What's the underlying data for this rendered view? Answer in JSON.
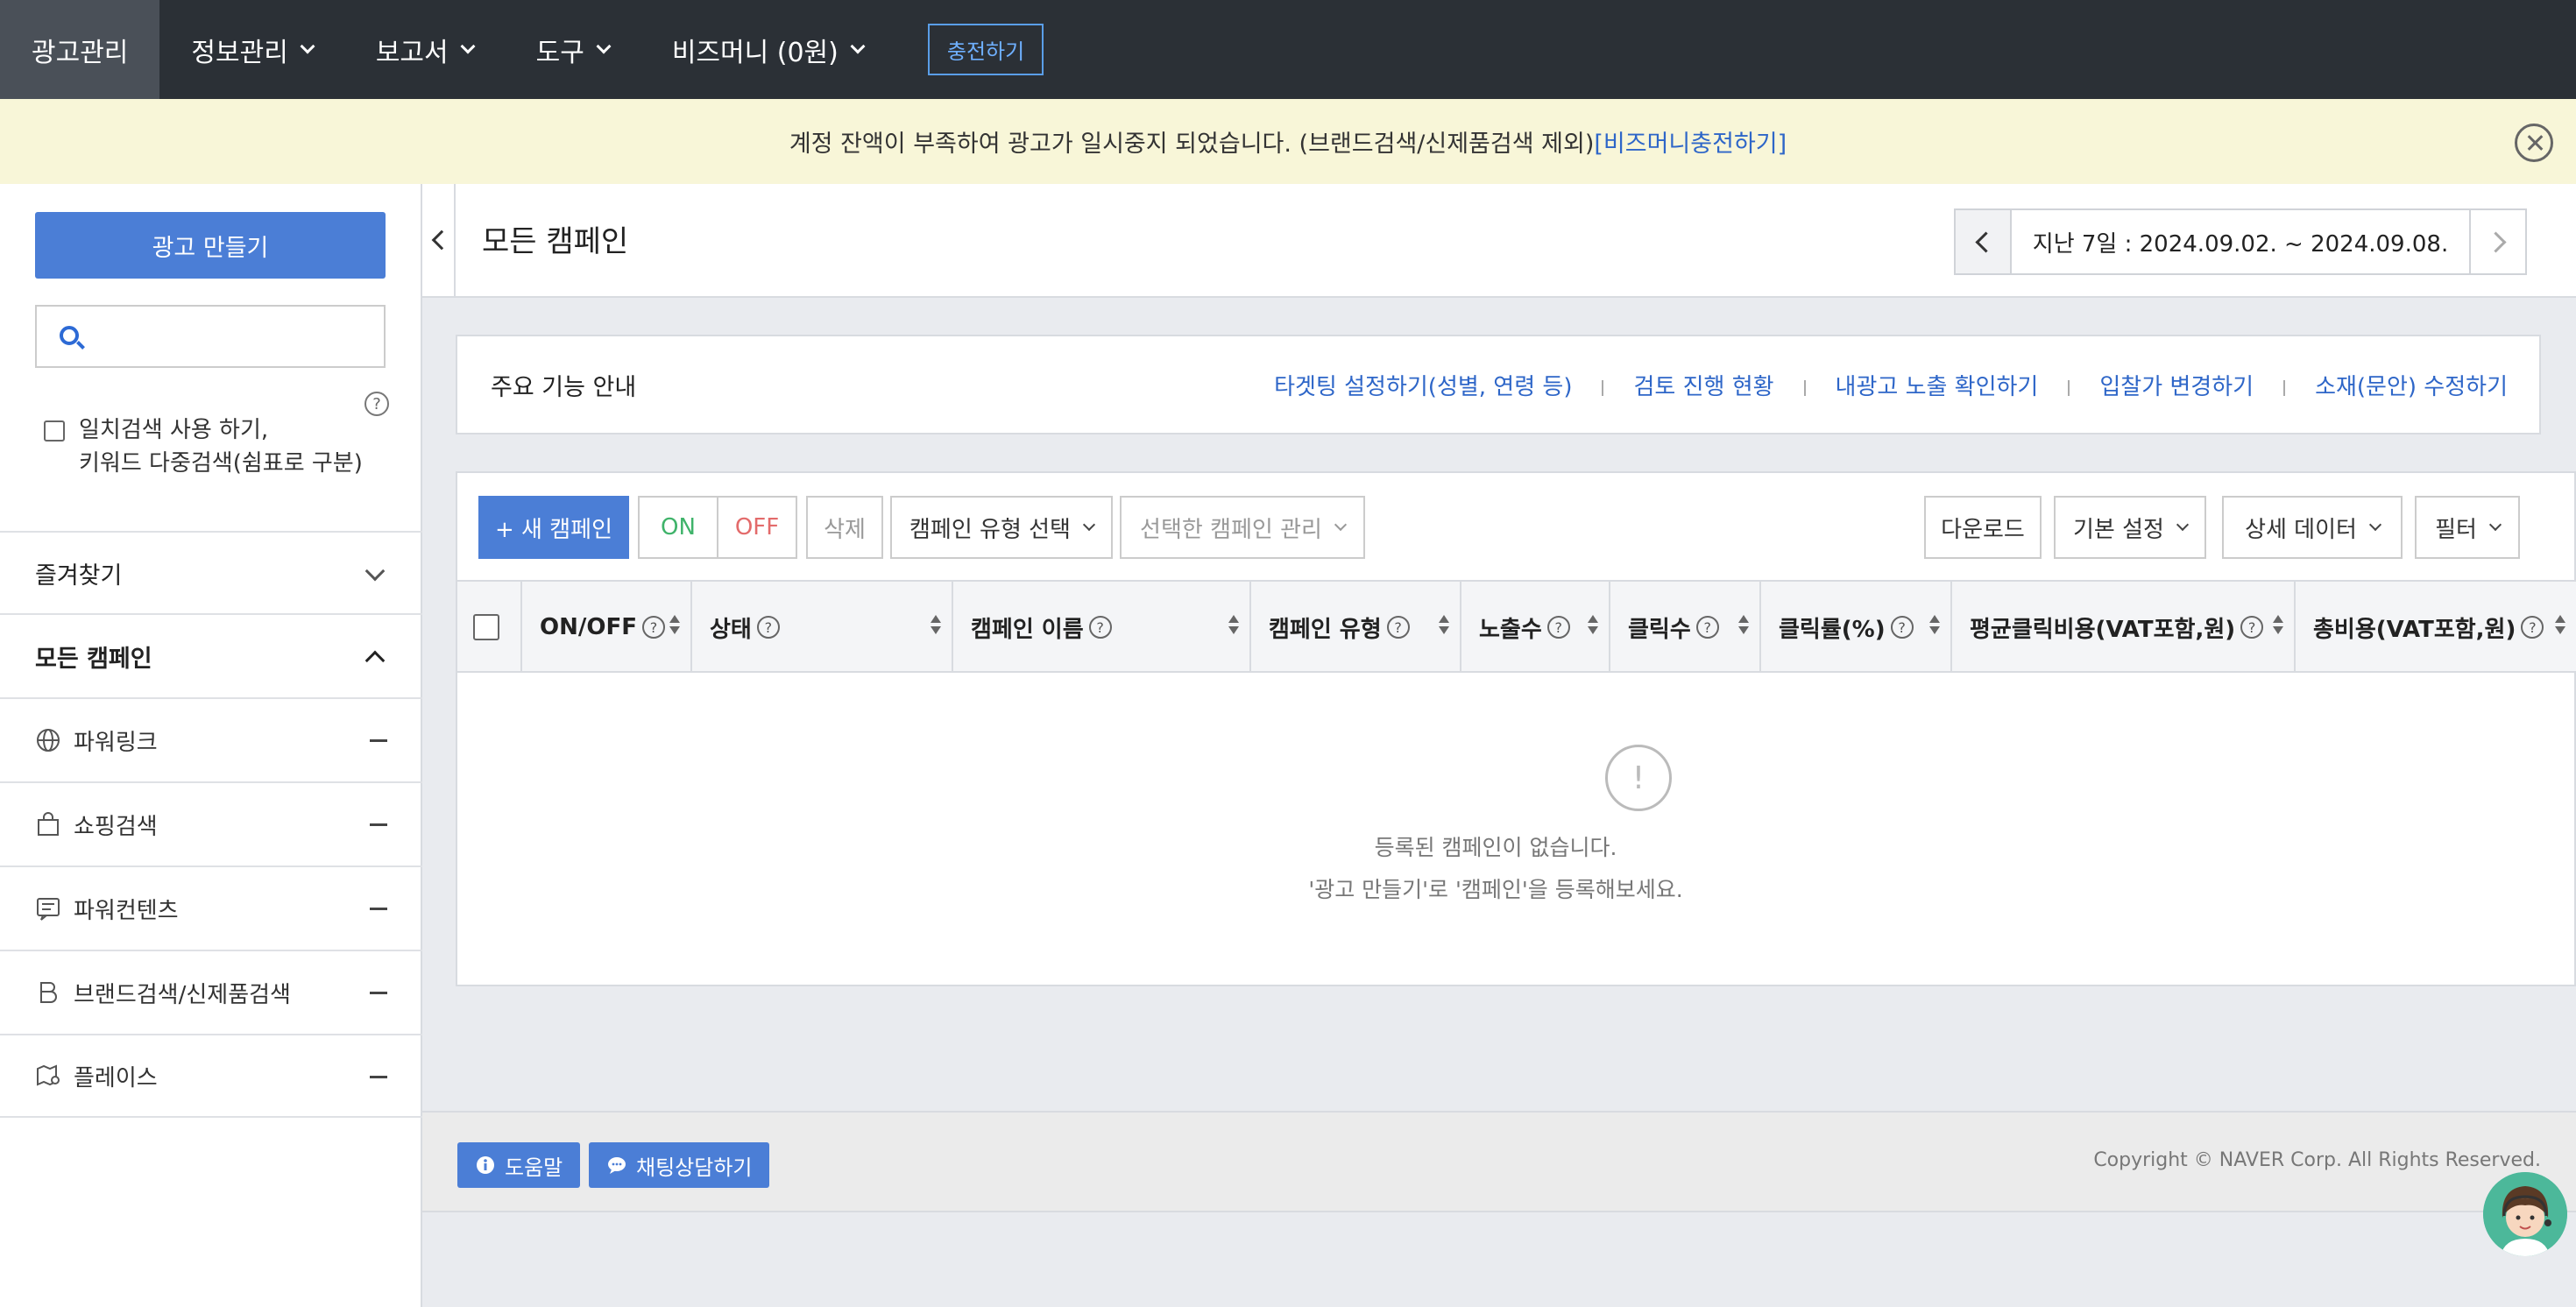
{
  "nav": {
    "items": [
      {
        "label": "광고관리"
      },
      {
        "label": "정보관리"
      },
      {
        "label": "보고서"
      },
      {
        "label": "도구"
      },
      {
        "label": "비즈머니 (0원)"
      }
    ],
    "charge_label": "충전하기"
  },
  "alert": {
    "message": "계정 잔액이 부족하여 광고가 일시중지 되었습니다. (브랜드검색/신제품검색 제외)",
    "link": "[비즈머니충전하기]"
  },
  "sidebar": {
    "create_label": "광고 만들기",
    "search_value": "",
    "help_icon": "?",
    "exact_line1": "일치검색 사용 하기,",
    "exact_line2": "키워드 다중검색(쉼표로 구분)",
    "favorites_label": "즐겨찾기",
    "all_campaigns_label": "모든 캠페인",
    "items": [
      {
        "label": "파워링크",
        "icon": "globe-icon"
      },
      {
        "label": "쇼핑검색",
        "icon": "shopping-bag-icon"
      },
      {
        "label": "파워컨텐츠",
        "icon": "content-icon"
      },
      {
        "label": "브랜드검색/신제품검색",
        "icon": "brand-icon"
      },
      {
        "label": "플레이스",
        "icon": "map-icon"
      }
    ]
  },
  "main": {
    "title": "모든 캠페인",
    "date_range": "지난 7일 : 2024.09.02. ~ 2024.09.08.",
    "guide": {
      "title": "주요 기능 안내",
      "links": [
        "타겟팅 설정하기(성별, 연령 등)",
        "검토 진행 현황",
        "내광고 노출 확인하기",
        "입찰가 변경하기",
        "소재(문안) 수정하기"
      ]
    },
    "toolbar": {
      "new_campaign": "+ 새 캠페인",
      "on": "ON",
      "off": "OFF",
      "delete": "삭제",
      "type_select": "캠페인 유형 선택",
      "manage_selected": "선택한 캠페인 관리",
      "download": "다운로드",
      "basic_settings": "기본 설정",
      "detail_data": "상세 데이터",
      "filter": "필터"
    },
    "columns": [
      "ON/OFF",
      "상태",
      "캠페인 이름",
      "캠페인 유형",
      "노출수",
      "클릭수",
      "클릭률(%)",
      "평균클릭비용(VAT포함,원)",
      "총비용(VAT포함,원)"
    ],
    "help_mark": "?",
    "empty_mark": "!",
    "empty_line1": "등록된 캠페인이 없습니다.",
    "empty_line2": "'광고 만들기'로 '캠페인'을 등록해보세요."
  },
  "footer": {
    "help_label": "도움말",
    "chat_label": "채팅상담하기",
    "copyright": "Copyright © NAVER Corp. All Rights Reserved."
  },
  "colors": {
    "nav_bg": "#2b3036",
    "alert_bg": "#f8f6d8",
    "primary": "#4b7ed6",
    "link": "#2e66c8",
    "on_green": "#3fb36a",
    "off_red": "#e36b6b"
  }
}
